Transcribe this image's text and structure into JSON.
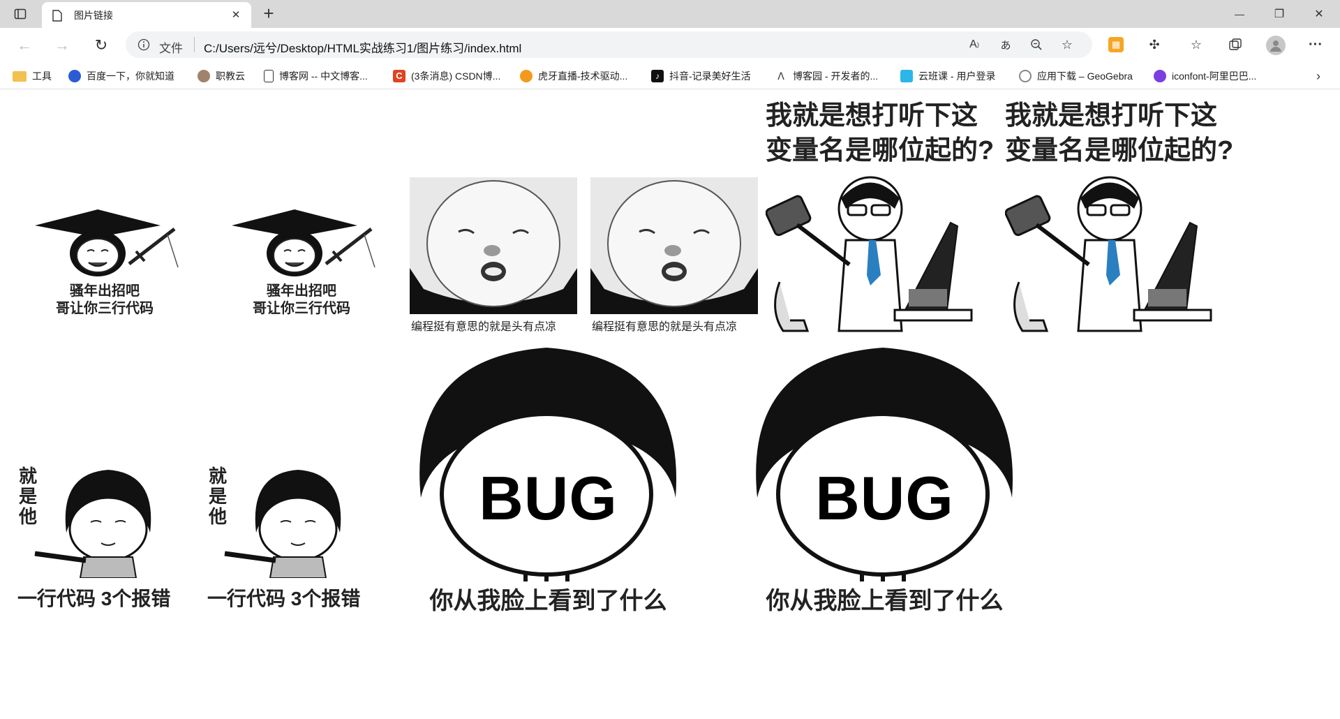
{
  "window": {
    "tab_title": "图片链接",
    "new_tab": "+",
    "controls": {
      "minimize": "—",
      "restore": "❐",
      "close": "✕"
    }
  },
  "address": {
    "prefix": "文件",
    "url": "C:/Users/远兮/Desktop/HTML实战练习1/图片练习/index.html"
  },
  "bookmarks": [
    {
      "label": "工具",
      "color": "#f2c14e"
    },
    {
      "label": "百度一下，你就知道",
      "color": "#2b5cd6"
    },
    {
      "label": "职教云",
      "color": "#a0826d"
    },
    {
      "label": "博客网 -- 中文博客...",
      "color": "#ffffff"
    },
    {
      "label": "(3条消息) CSDN博...",
      "color": "#e0431f"
    },
    {
      "label": "虎牙直播-技术驱动...",
      "color": "#f39a1e"
    },
    {
      "label": "抖音-记录美好生活",
      "color": "#111111"
    },
    {
      "label": "博客园 - 开发者的...",
      "color": "#ffffff"
    },
    {
      "label": "云班课 - 用户登录",
      "color": "#2bb6e8"
    },
    {
      "label": "应用下载 – GeoGebra",
      "color": "#888888"
    },
    {
      "label": "iconfont-阿里巴巴...",
      "color": "#7a3fe0"
    }
  ],
  "memes": {
    "graduate_1": [
      "骚年出招吧",
      "哥让你三行代码"
    ],
    "graduate_2": [
      "骚年出招吧",
      "哥让你三行代码"
    ],
    "panda_1": "编程挺有意思的就是头有点凉",
    "panda_2": "编程挺有意思的就是头有点凉",
    "programmer_1": [
      "我就是想打听下这",
      "变量名是哪位起的?"
    ],
    "programmer_2": [
      "我就是想打听下这",
      "变量名是哪位起的?"
    ],
    "pointer_1": {
      "side": "就是他",
      "bottom": "一行代码 3个报错"
    },
    "pointer_2": {
      "side": "就是他",
      "bottom": "一行代码 3个报错"
    },
    "bug_1": {
      "face": "BUG",
      "bottom": "你从我脸上看到了什么"
    },
    "bug_2": {
      "face": "BUG",
      "bottom": "你从我脸上看到了什么"
    }
  }
}
